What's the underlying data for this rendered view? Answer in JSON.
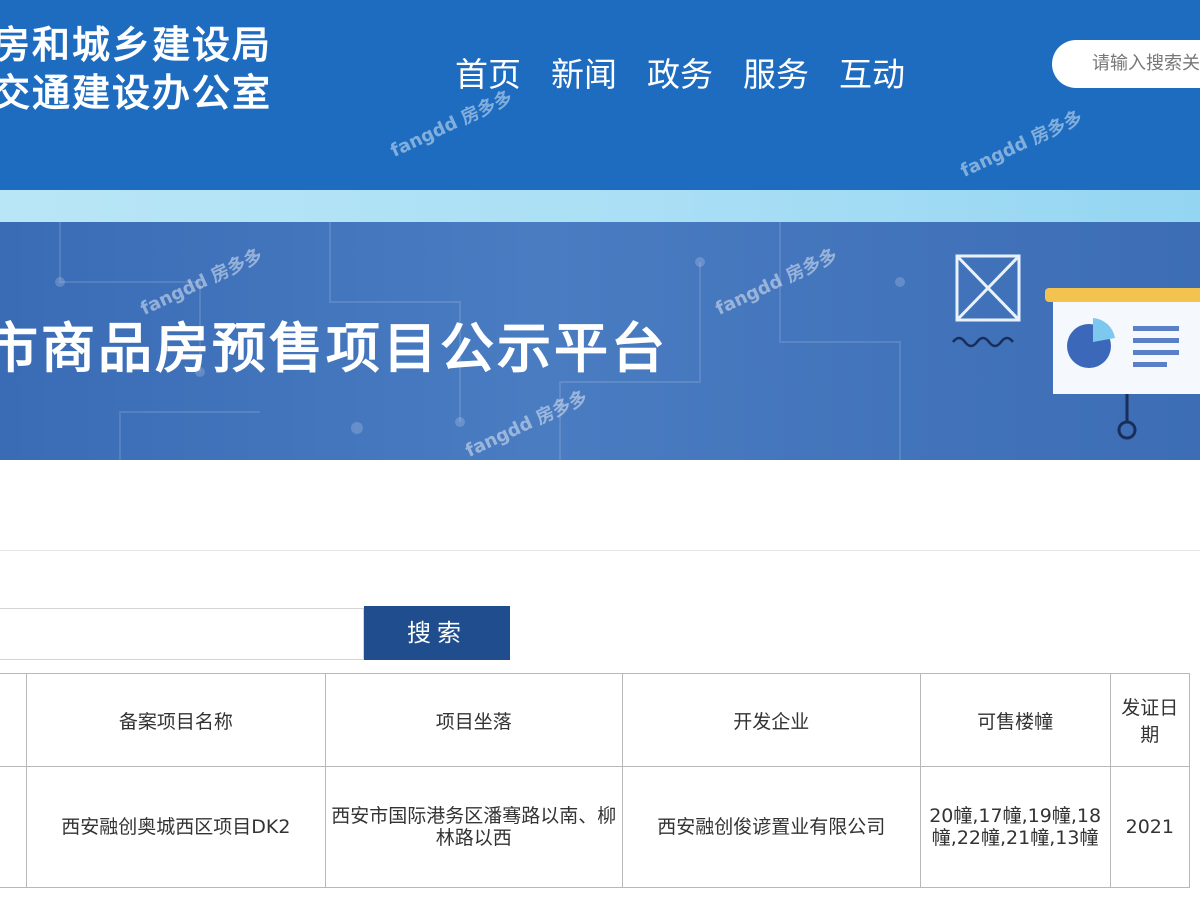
{
  "header": {
    "agency_line1": "房和城乡建设局",
    "agency_line2": "交通建设办公室",
    "nav": [
      "首页",
      "新闻",
      "政务",
      "服务",
      "互动"
    ],
    "search_placeholder": "请输入搜索关键词"
  },
  "banner": {
    "title": "市商品房预售项目公示平台"
  },
  "search": {
    "button_label": "搜索"
  },
  "table": {
    "headers": [
      "",
      "备案项目名称",
      "项目坐落",
      "开发企业",
      "可售楼幢",
      "发证日期"
    ],
    "rows": [
      [
        "",
        "西安融创奥城西区项目DK2",
        "西安市国际港务区潘骞路以南、柳林路以西",
        "西安融创俊谚置业有限公司",
        "20幢,17幢,19幢,18幢,22幢,21幢,13幢",
        "2021"
      ]
    ]
  },
  "watermark": "fangdd 房多多",
  "colors": {
    "header_bg": "#1d6cc0",
    "banner_bg": "#3a6cb6",
    "button_bg": "#1f4d8e",
    "strip": "#a8def5"
  }
}
